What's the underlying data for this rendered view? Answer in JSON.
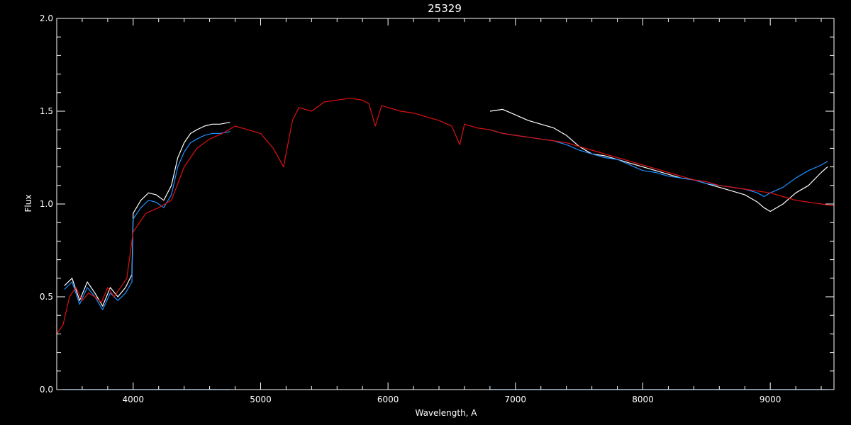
{
  "chart_data": {
    "type": "line",
    "title": "25329",
    "xlabel": "Wavelength, A",
    "ylabel": "Flux",
    "xlim": [
      3400,
      9500
    ],
    "ylim": [
      0.0,
      2.0
    ],
    "xticks": [
      4000,
      5000,
      6000,
      7000,
      8000,
      9000
    ],
    "yticks": [
      0.0,
      0.5,
      1.0,
      1.5,
      2.0
    ],
    "ytick_labels": [
      "0.0",
      "0.5",
      "1.0",
      "1.5",
      "2.0"
    ],
    "grid": false,
    "colors": {
      "background": "#000000",
      "axes": "#ffffff",
      "white": "#ffffff",
      "blue": "#1e90ff",
      "red": "#dd1111"
    },
    "series": [
      {
        "color": "#ffffff",
        "segments": [
          {
            "x": [
              3460,
              3520,
              3580,
              3640,
              3700,
              3760,
              3820,
              3880,
              3940,
              3990,
              4000,
              4060,
              4120,
              4180,
              4240,
              4300,
              4350,
              4400,
              4450,
              4500,
              4560,
              4620,
              4680,
              4760
            ],
            "y": [
              0.56,
              0.6,
              0.48,
              0.58,
              0.52,
              0.45,
              0.55,
              0.5,
              0.55,
              0.62,
              0.95,
              1.02,
              1.06,
              1.05,
              1.02,
              1.1,
              1.25,
              1.33,
              1.38,
              1.4,
              1.42,
              1.43,
              1.43,
              1.44
            ]
          },
          {
            "x": [
              6800,
              6900,
              7000,
              7100,
              7200,
              7300,
              7400,
              7500,
              7600,
              7700,
              7800,
              7900,
              8000,
              8100,
              8200,
              8300,
              8400,
              8500,
              8600,
              8700,
              8800,
              8900,
              8950,
              9000,
              9100,
              9200,
              9300,
              9400,
              9450
            ],
            "y": [
              1.5,
              1.51,
              1.48,
              1.45,
              1.43,
              1.41,
              1.37,
              1.31,
              1.27,
              1.26,
              1.24,
              1.22,
              1.2,
              1.18,
              1.16,
              1.14,
              1.13,
              1.11,
              1.09,
              1.07,
              1.05,
              1.01,
              0.98,
              0.96,
              1.0,
              1.06,
              1.1,
              1.17,
              1.2
            ]
          }
        ]
      },
      {
        "color": "#1e90ff",
        "segments": [
          {
            "x": [
              3460,
              3520,
              3580,
              3640,
              3700,
              3760,
              3820,
              3880,
              3940,
              3990,
              4000,
              4060,
              4120,
              4180,
              4240,
              4300,
              4350,
              4400,
              4450,
              4500,
              4560,
              4620,
              4680,
              4760
            ],
            "y": [
              0.54,
              0.58,
              0.46,
              0.55,
              0.5,
              0.43,
              0.52,
              0.48,
              0.52,
              0.58,
              0.92,
              0.98,
              1.02,
              1.01,
              0.98,
              1.05,
              1.2,
              1.28,
              1.33,
              1.35,
              1.37,
              1.38,
              1.38,
              1.39
            ]
          },
          {
            "x": [
              6800,
              6900,
              7000,
              7100,
              7200,
              7300,
              7400,
              7500,
              7600,
              7700,
              7800,
              7900,
              8000,
              8100,
              8200,
              8300,
              8400,
              8500,
              8600,
              8700,
              8800,
              8900,
              8950,
              9000,
              9100,
              9200,
              9300,
              9400,
              9450
            ],
            "y": [
              1.4,
              1.38,
              1.37,
              1.36,
              1.35,
              1.34,
              1.32,
              1.29,
              1.27,
              1.25,
              1.24,
              1.21,
              1.18,
              1.17,
              1.15,
              1.14,
              1.13,
              1.11,
              1.1,
              1.09,
              1.08,
              1.06,
              1.04,
              1.06,
              1.09,
              1.14,
              1.18,
              1.21,
              1.23
            ]
          },
          {
            "x": [
              3450,
              4760
            ],
            "y": [
              0.0,
              0.0
            ]
          },
          {
            "x": [
              6800,
              9450
            ],
            "y": [
              0.0,
              0.0
            ]
          }
        ]
      },
      {
        "color": "#dd1111",
        "segments": [
          {
            "x": [
              3400,
              3450,
              3500,
              3550,
              3600,
              3650,
              3700,
              3750,
              3800,
              3850,
              3900,
              3950,
              4000,
              4100,
              4200,
              4300,
              4400,
              4500,
              4600,
              4700,
              4800,
              4900,
              5000,
              5100,
              5180,
              5250,
              5300,
              5400,
              5500,
              5600,
              5700,
              5800,
              5850,
              5900,
              5950,
              6000,
              6100,
              6200,
              6300,
              6400,
              6500,
              6563,
              6600,
              6700,
              6800,
              6900,
              7000,
              7100,
              7200,
              7300,
              7400,
              7500,
              7600,
              7700,
              7800,
              7900,
              8000,
              8100,
              8200,
              8300,
              8400,
              8500,
              8600,
              8700,
              8800,
              8900,
              9000,
              9100,
              9200,
              9300,
              9400,
              9500
            ],
            "y": [
              0.3,
              0.35,
              0.5,
              0.55,
              0.48,
              0.52,
              0.5,
              0.47,
              0.55,
              0.5,
              0.55,
              0.6,
              0.85,
              0.95,
              0.98,
              1.02,
              1.2,
              1.3,
              1.35,
              1.38,
              1.42,
              1.4,
              1.38,
              1.3,
              1.2,
              1.45,
              1.52,
              1.5,
              1.55,
              1.56,
              1.57,
              1.56,
              1.54,
              1.42,
              1.53,
              1.52,
              1.5,
              1.49,
              1.47,
              1.45,
              1.42,
              1.32,
              1.43,
              1.41,
              1.4,
              1.38,
              1.37,
              1.36,
              1.35,
              1.34,
              1.33,
              1.31,
              1.29,
              1.27,
              1.25,
              1.23,
              1.21,
              1.19,
              1.17,
              1.15,
              1.13,
              1.12,
              1.1,
              1.09,
              1.08,
              1.07,
              1.06,
              1.04,
              1.02,
              1.01,
              1.0,
              0.99
            ]
          }
        ]
      }
    ]
  }
}
